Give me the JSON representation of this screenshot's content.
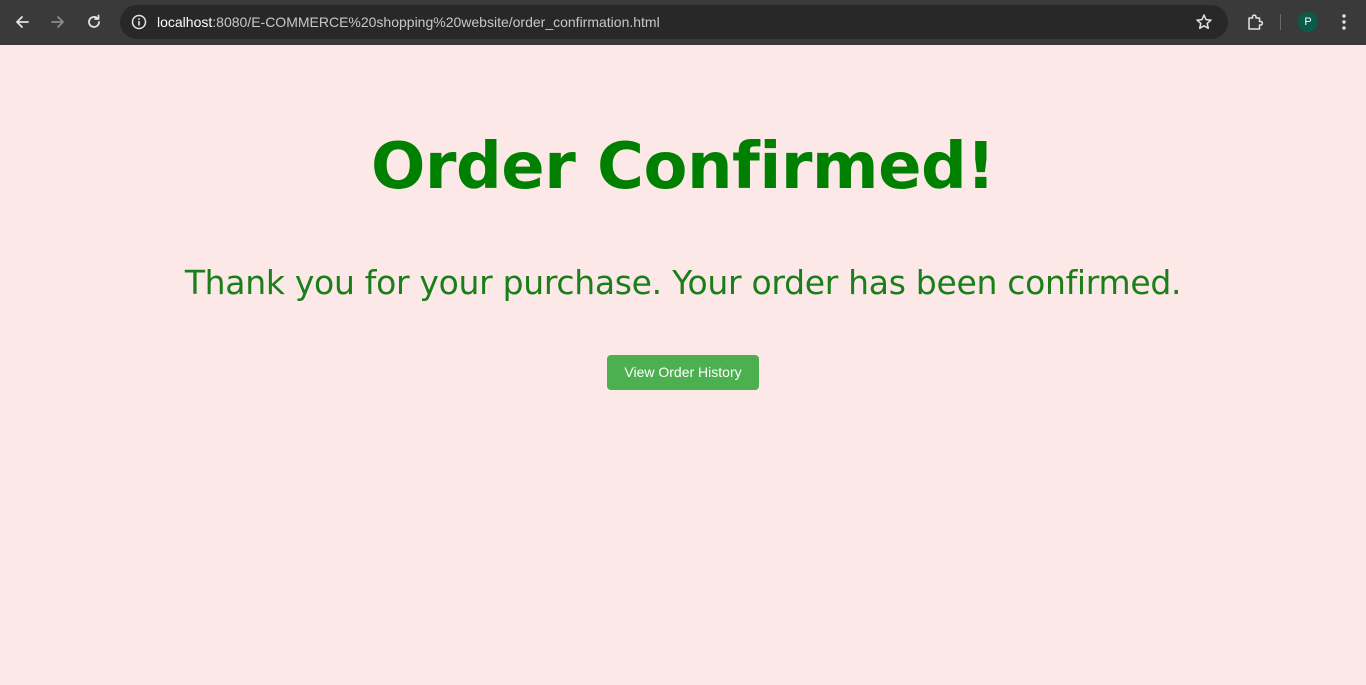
{
  "browser": {
    "url_host": "localhost",
    "url_rest": ":8080/E-COMMERCE%20shopping%20website/order_confirmation.html",
    "profile_initial": "P",
    "icons": {
      "back": "arrow-left-icon",
      "forward": "arrow-right-icon",
      "reload": "reload-icon",
      "site_info": "info-icon",
      "bookmark": "star-icon",
      "extensions": "puzzle-icon",
      "menu": "kebab-menu-icon"
    },
    "colors": {
      "toolbar": "#3a3a3a",
      "omnibox": "#282828",
      "avatar": "#0b5a4a"
    }
  },
  "page": {
    "heading": "Order Confirmed!",
    "message": "Thank you for your purchase. Your order has been confirmed.",
    "button_label": "View Order History",
    "colors": {
      "background": "#fde8e8",
      "heading": "#008000",
      "message": "#1a7f1a",
      "button": "#4caf50",
      "button_text": "#ffffff"
    }
  }
}
